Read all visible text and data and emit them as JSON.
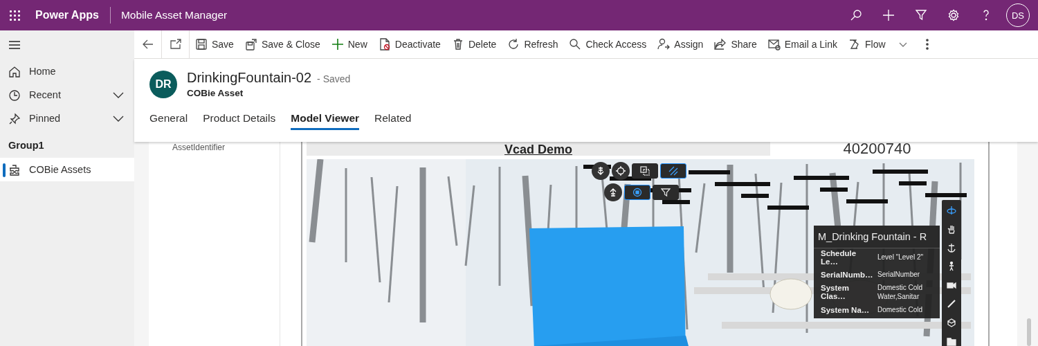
{
  "app_bar": {
    "brand": "Power Apps",
    "app_name": "Mobile Asset Manager",
    "user_initials": "DS",
    "actions": [
      {
        "kind": "search"
      },
      {
        "kind": "add"
      },
      {
        "kind": "filter"
      },
      {
        "kind": "settings"
      },
      {
        "kind": "help"
      }
    ]
  },
  "sidebar": {
    "items": [
      {
        "label": "Home",
        "kind": "home"
      },
      {
        "label": "Recent",
        "kind": "recent"
      },
      {
        "label": "Pinned",
        "kind": "pinned"
      }
    ],
    "group": "Group1",
    "group_items": [
      {
        "label": "COBie Assets",
        "selected": true
      }
    ]
  },
  "command_bar": {
    "items": [
      {
        "label": "Save",
        "kind": "save",
        "dropdown": false
      },
      {
        "label": "Save & Close",
        "kind": "save-close",
        "dropdown": false
      },
      {
        "label": "New",
        "kind": "new",
        "dropdown": false
      },
      {
        "label": "Deactivate",
        "kind": "deactivate",
        "dropdown": false
      },
      {
        "label": "Delete",
        "kind": "delete",
        "dropdown": false
      },
      {
        "label": "Refresh",
        "kind": "refresh",
        "dropdown": false
      },
      {
        "label": "Check Access",
        "kind": "check-access",
        "dropdown": false
      },
      {
        "label": "Assign",
        "kind": "assign",
        "dropdown": false
      },
      {
        "label": "Share",
        "kind": "share",
        "dropdown": false
      },
      {
        "label": "Email a Link",
        "kind": "email",
        "dropdown": false
      },
      {
        "label": "Flow",
        "kind": "flow",
        "dropdown": true
      }
    ]
  },
  "record": {
    "initials": "DR",
    "title": "DrinkingFountain-02",
    "status": "- Saved",
    "entity": "COBie Asset"
  },
  "tabs": [
    {
      "label": "General",
      "selected": false
    },
    {
      "label": "Product Details",
      "selected": false
    },
    {
      "label": "Model Viewer",
      "selected": true
    },
    {
      "label": "Related",
      "selected": false
    }
  ],
  "form": {
    "field_label": "AssetIdentifier",
    "viewer_heading": "Vcad Demo",
    "asset_number": "40200740"
  },
  "viewer": {
    "top_tools": [
      {
        "kind": "level-down",
        "selected": false
      },
      {
        "kind": "target",
        "selected": false
      },
      {
        "kind": "section-box",
        "selected": false
      },
      {
        "kind": "hatch",
        "selected": true
      }
    ],
    "second_tools": [
      {
        "kind": "level-up",
        "selected": false
      },
      {
        "kind": "isolate",
        "selected": true
      },
      {
        "kind": "filter",
        "selected": false
      }
    ],
    "nav_tools": [
      {
        "kind": "orbit",
        "selected": true
      },
      {
        "kind": "pan",
        "selected": false
      },
      {
        "kind": "anchor",
        "selected": false
      },
      {
        "kind": "walk",
        "selected": false
      },
      {
        "kind": "camera",
        "selected": false
      },
      {
        "kind": "measure",
        "selected": false
      },
      {
        "kind": "explode",
        "selected": false
      },
      {
        "kind": "folder",
        "selected": false
      }
    ],
    "properties": {
      "title": "M_Drinking Fountain - R",
      "rows": [
        {
          "name": "Schedule Le…",
          "value": "Level \"Level 2\""
        },
        {
          "name": "SerialNumb…",
          "value": "SerialNumber"
        },
        {
          "name": "System Clas…",
          "value": "Domestic Cold Water,Sanitar"
        },
        {
          "name": "System Na…",
          "value": "Domestic Cold"
        }
      ]
    }
  }
}
